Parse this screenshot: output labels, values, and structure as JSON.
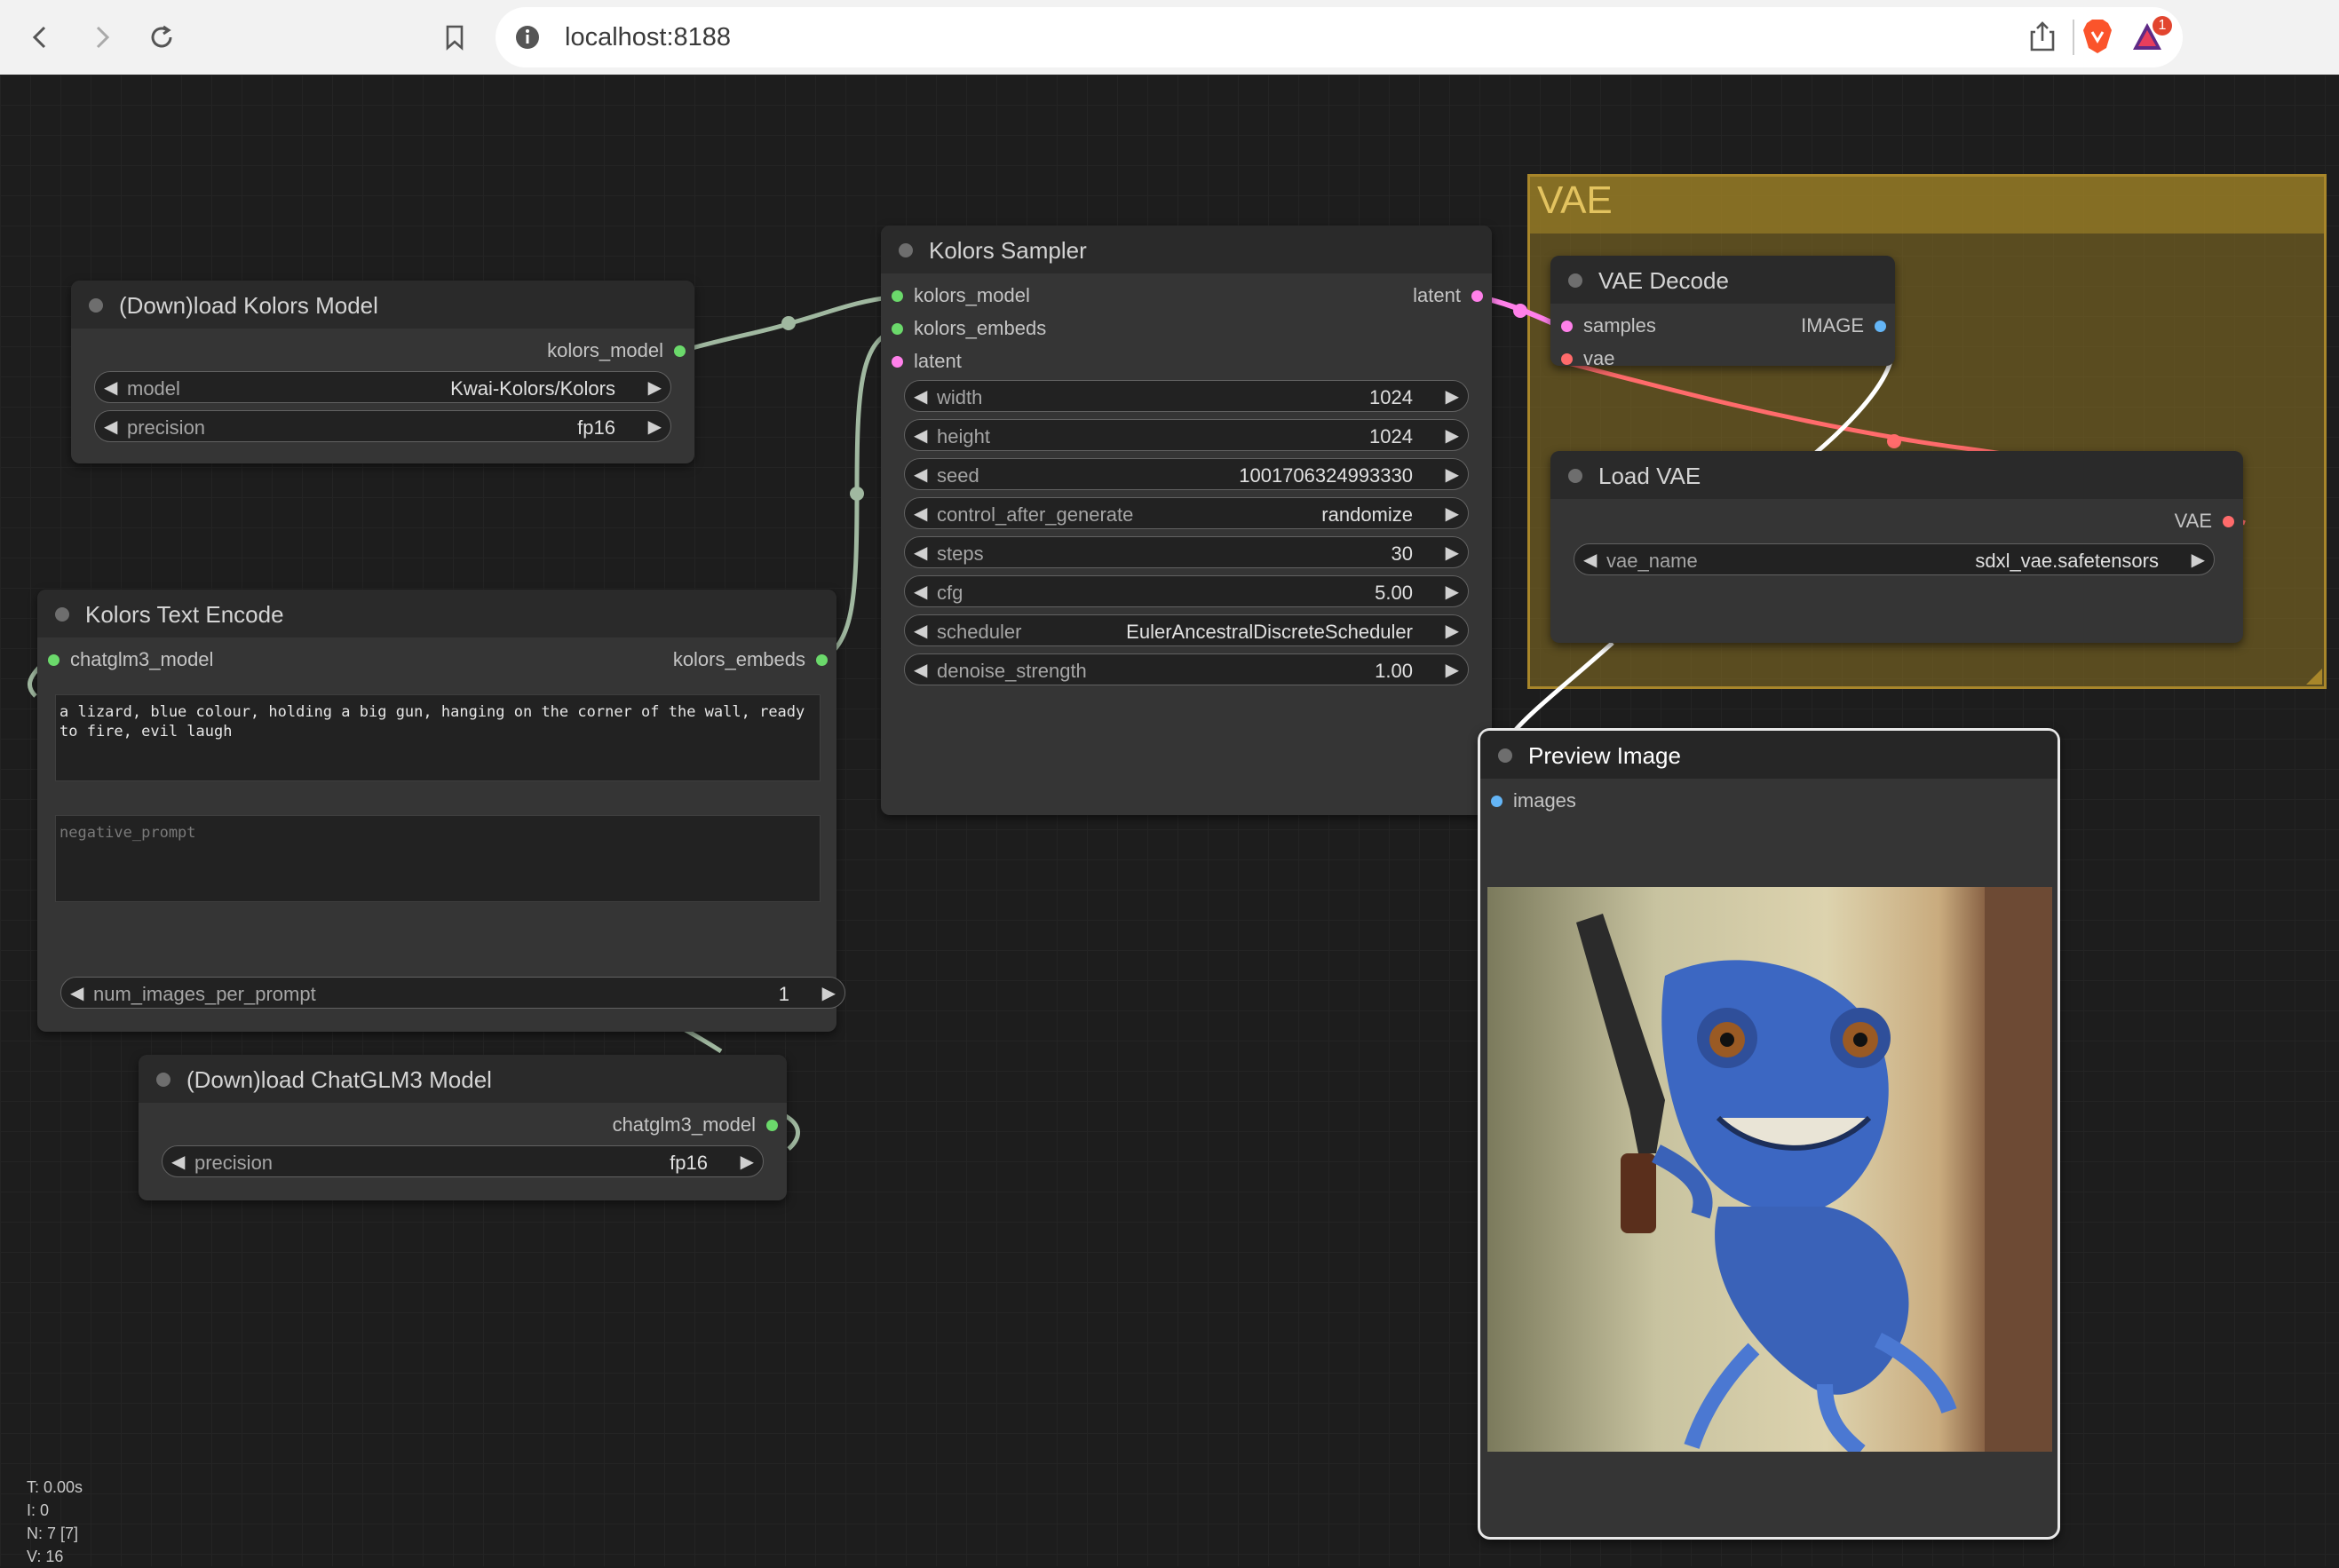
{
  "browser": {
    "url": "localhost:8188",
    "notification_count": "1",
    "icons": [
      "back-icon",
      "forward-icon",
      "reload-icon",
      "bookmark-icon",
      "site-info-icon",
      "share-icon",
      "brave-icon",
      "brave-rewards-icon"
    ]
  },
  "group": {
    "title": "VAE"
  },
  "nodes": {
    "load_kolors": {
      "title": "(Down)load Kolors Model",
      "output": "kolors_model",
      "widgets": [
        {
          "label": "model",
          "value": "Kwai-Kolors/Kolors"
        },
        {
          "label": "precision",
          "value": "fp16"
        }
      ]
    },
    "text_encode": {
      "title": "Kolors Text Encode",
      "input": "chatglm3_model",
      "output": "kolors_embeds",
      "prompt": "a lizard, blue colour, holding a big gun, hanging on the corner of the wall, ready to fire, evil laugh",
      "negative_placeholder": "negative_prompt",
      "widgets": [
        {
          "label": "num_images_per_prompt",
          "value": "1"
        }
      ]
    },
    "load_chatglm": {
      "title": "(Down)load ChatGLM3 Model",
      "output": "chatglm3_model",
      "widgets": [
        {
          "label": "precision",
          "value": "fp16"
        }
      ]
    },
    "sampler": {
      "title": "Kolors Sampler",
      "inputs": [
        "kolors_model",
        "kolors_embeds",
        "latent"
      ],
      "output": "latent",
      "widgets": [
        {
          "label": "width",
          "value": "1024"
        },
        {
          "label": "height",
          "value": "1024"
        },
        {
          "label": "seed",
          "value": "1001706324993330"
        },
        {
          "label": "control_after_generate",
          "value": "randomize"
        },
        {
          "label": "steps",
          "value": "30"
        },
        {
          "label": "cfg",
          "value": "5.00"
        },
        {
          "label": "scheduler",
          "value": "EulerAncestralDiscreteScheduler"
        },
        {
          "label": "denoise_strength",
          "value": "1.00"
        }
      ]
    },
    "vae_decode": {
      "title": "VAE Decode",
      "inputs": [
        "samples",
        "vae"
      ],
      "output": "IMAGE"
    },
    "load_vae": {
      "title": "Load VAE",
      "output": "VAE",
      "widgets": [
        {
          "label": "vae_name",
          "value": "sdxl_vae.safetensors"
        }
      ]
    },
    "preview": {
      "title": "Preview Image",
      "input": "images"
    }
  },
  "stats": {
    "t": "T: 0.00s",
    "i": "I: 0",
    "n": "N: 7 [7]",
    "v": "V: 16"
  },
  "colors": {
    "model_link": "#a0b8a0",
    "latent_link": "#ff80ea",
    "vae_link": "#ff6b6b",
    "image_link": "#ffffff",
    "group": "#a8862a"
  }
}
